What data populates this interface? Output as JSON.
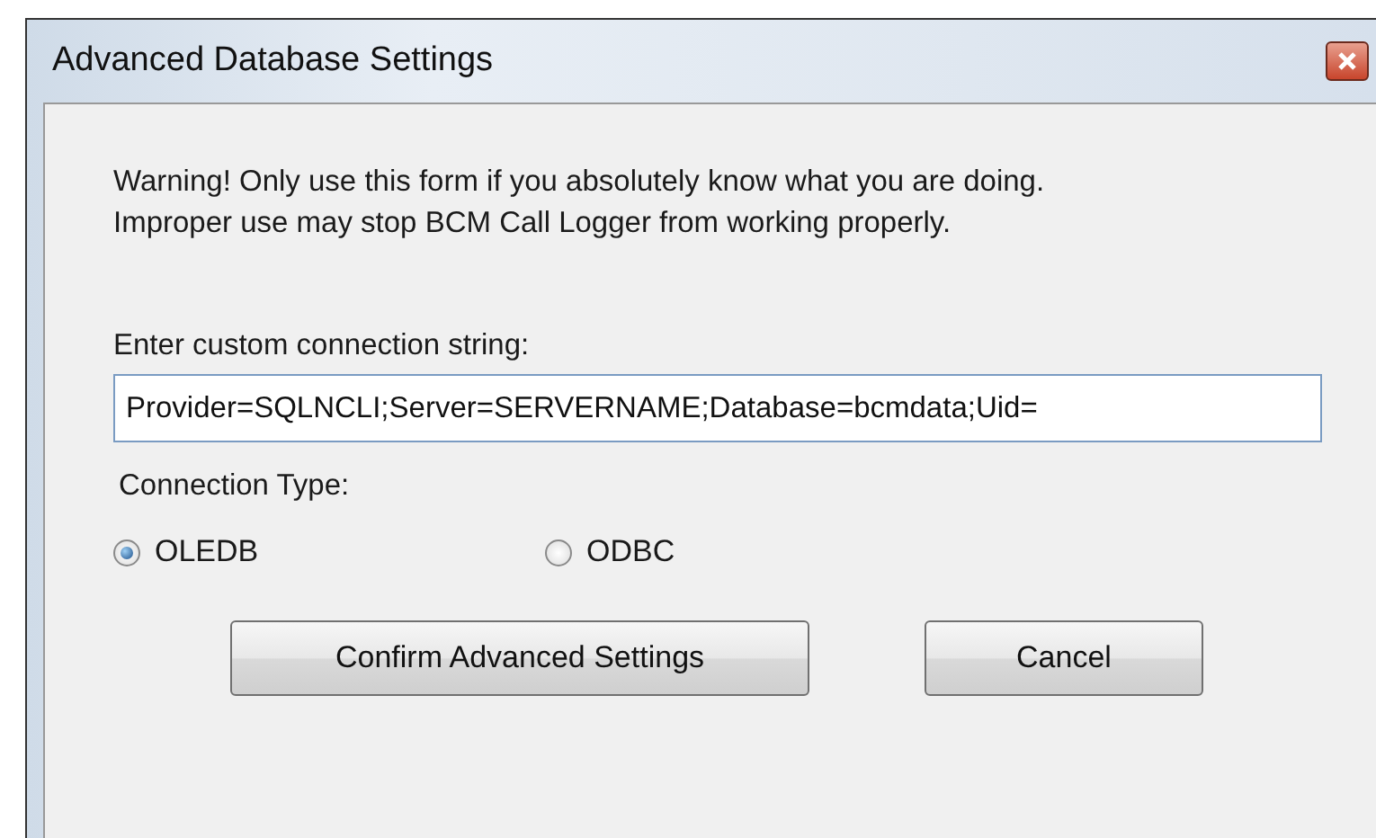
{
  "window": {
    "title": "Advanced Database Settings"
  },
  "warning": [
    "Warning! Only use this form if you absolutely know what you are doing.",
    "Improper use may stop BCM Call Logger from working properly."
  ],
  "connection_string": {
    "label": "Enter custom connection string:",
    "value": "Provider=SQLNCLI;Server=SERVERNAME;Database=bcmdata;Uid="
  },
  "connection_type": {
    "label": "Connection Type:",
    "options": [
      {
        "label": "OLEDB",
        "selected": true
      },
      {
        "label": "ODBC",
        "selected": false
      }
    ]
  },
  "buttons": [
    "Confirm Advanced Settings",
    "Cancel"
  ]
}
